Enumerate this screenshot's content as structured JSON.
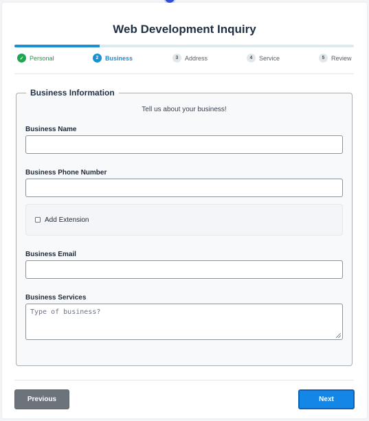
{
  "form": {
    "title": "Web Development Inquiry"
  },
  "progress": {
    "fraction": 0.25
  },
  "steps": [
    {
      "number": "✓",
      "label": "Personal",
      "state": "done"
    },
    {
      "number": "2",
      "label": "Business",
      "state": "active"
    },
    {
      "number": "3",
      "label": "Address",
      "state": "pending"
    },
    {
      "number": "4",
      "label": "Service",
      "state": "pending"
    },
    {
      "number": "5",
      "label": "Review",
      "state": "pending"
    }
  ],
  "section": {
    "legend": "Business Information",
    "subtitle": "Tell us about your business!",
    "business_name": {
      "label": "Business Name",
      "value": "",
      "placeholder": ""
    },
    "business_phone": {
      "label": "Business Phone Number",
      "value": "",
      "placeholder": ""
    },
    "extension": {
      "label": "Add Extension",
      "checked": false
    },
    "business_email": {
      "label": "Business Email",
      "value": "",
      "placeholder": ""
    },
    "business_services": {
      "label": "Business Services",
      "value": "",
      "placeholder": "Type of business?"
    }
  },
  "buttons": {
    "previous": "Previous",
    "next": "Next"
  },
  "colors": {
    "accent": "#1a8fd2",
    "success": "#1fa54f",
    "next_button": "#1486e6",
    "previous_button": "#6c737b",
    "title": "#1e2f44"
  }
}
